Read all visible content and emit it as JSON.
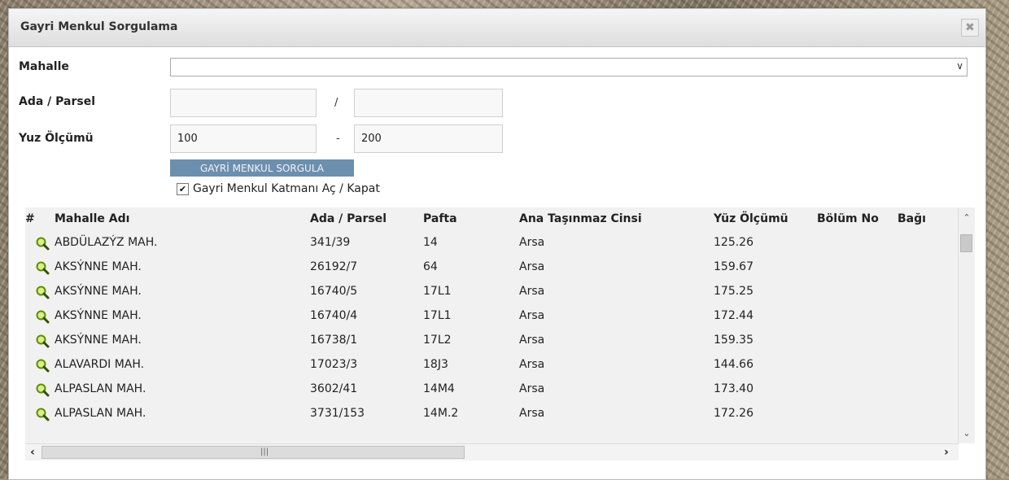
{
  "dialog": {
    "title": "Gayri Menkul Sorgulama",
    "close_label": "✖"
  },
  "form": {
    "mahalle_label": "Mahalle",
    "mahalle_value": "",
    "ada_parsel_label": "Ada / Parsel",
    "ada_value": "",
    "ada_separator": "/",
    "parsel_value": "",
    "yuz_olcumu_label": "Yuz Ölçümü",
    "yuz_min": "100",
    "yuz_separator": "-",
    "yuz_max": "200",
    "query_button": "GAYRİ MENKUL SORGULA",
    "layer_toggle_label": "Gayri Menkul Katmanı Aç / Kapat",
    "layer_toggle_checked": true
  },
  "table": {
    "columns": [
      "#",
      "Mahalle Adı",
      "Ada / Parsel",
      "Pafta",
      "Ana Taşınmaz Cinsi",
      "Yüz Ölçümü",
      "Bölüm No",
      "Bağı"
    ],
    "rows": [
      {
        "mahalle": "ABDÜLAZÝZ MAH.",
        "ada_parsel": "341/39",
        "pafta": "14",
        "cins": "Arsa",
        "yuz": "125.26"
      },
      {
        "mahalle": "AKSÝNNE MAH.",
        "ada_parsel": "26192/7",
        "pafta": "64",
        "cins": "Arsa",
        "yuz": "159.67"
      },
      {
        "mahalle": "AKSÝNNE MAH.",
        "ada_parsel": "16740/5",
        "pafta": "17L1",
        "cins": "Arsa",
        "yuz": "175.25"
      },
      {
        "mahalle": "AKSÝNNE MAH.",
        "ada_parsel": "16740/4",
        "pafta": "17L1",
        "cins": "Arsa",
        "yuz": "172.44"
      },
      {
        "mahalle": "AKSÝNNE MAH.",
        "ada_parsel": "16738/1",
        "pafta": "17L2",
        "cins": "Arsa",
        "yuz": "159.35"
      },
      {
        "mahalle": "ALAVARDI MAH.",
        "ada_parsel": "17023/3",
        "pafta": "18J3",
        "cins": "Arsa",
        "yuz": "144.66"
      },
      {
        "mahalle": "ALPASLAN MAH.",
        "ada_parsel": "3602/41",
        "pafta": "14M4",
        "cins": "Arsa",
        "yuz": "173.40"
      },
      {
        "mahalle": "ALPASLAN MAH.",
        "ada_parsel": "3731/153",
        "pafta": "14M.2",
        "cins": "Arsa",
        "yuz": "172.26"
      }
    ]
  },
  "colors": {
    "button_bg": "#6d8fae",
    "grid_bg": "#f1f1f1",
    "magnifier": "#7cb800"
  },
  "icons": {
    "row_action": "magnifier-icon",
    "close": "close-icon",
    "dropdown": "chevron-down-icon"
  }
}
